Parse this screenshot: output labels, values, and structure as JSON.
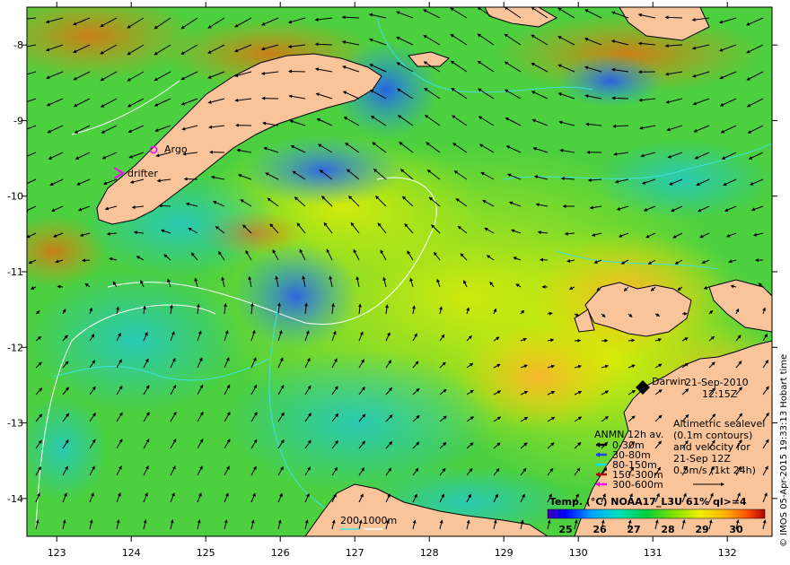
{
  "map": {
    "lon_ticks": [
      "123",
      "124",
      "125",
      "126",
      "127",
      "128",
      "129",
      "130",
      "131",
      "132"
    ],
    "lat_ticks": [
      "-8",
      "-9",
      "-10",
      "-11",
      "-12",
      "-13",
      "-14"
    ],
    "lon_range": [
      122.6,
      132.6
    ],
    "lat_range": [
      -7.5,
      -14.5
    ]
  },
  "markers": {
    "argo_label": "Argo",
    "drifter_label": "drifter",
    "city_label": "Darwin",
    "argo_color": "#ff00ff",
    "drifter_color": "#ff00ff"
  },
  "header": {
    "date": "21-Sep-2010",
    "time": "12:15Z"
  },
  "legend_sealevel": {
    "line1": "Altimetric sealevel",
    "line2": "(0.1m contours)",
    "line3": "and velocity for",
    "line4": "21-Sep 12Z",
    "line5": "0.5m/s (1kt 24h)"
  },
  "legend_anmn": {
    "title": "ANMN 12h av.",
    "items": [
      {
        "label": "0-30m",
        "color": "#000000"
      },
      {
        "label": "30-80m",
        "color": "#1f3fff"
      },
      {
        "label": "80-150m",
        "color": "#00e0e0"
      },
      {
        "label": "150-300m",
        "color": "#b00000"
      },
      {
        "label": "300-600m",
        "color": "#ff00ff"
      }
    ]
  },
  "colorbar": {
    "title": "Temp. (°C) NOAA17_L3U 61% ql>=4",
    "ticks": [
      "25",
      "26",
      "27",
      "28",
      "29",
      "30"
    ]
  },
  "bathymetry_legend": {
    "label": "200  1000m"
  },
  "credit": "© IMOS 05-Apr-2015 19:33:13 Hobart time",
  "colors": {
    "land": "#f9c49a",
    "coast": "#000000",
    "contour_200": "#40e0e0",
    "contour_1000": "#ffffff"
  }
}
